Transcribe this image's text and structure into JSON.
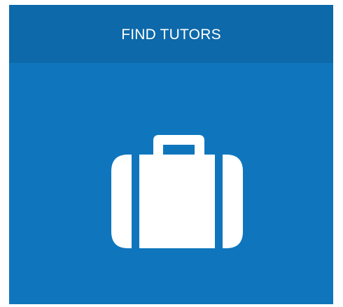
{
  "tile": {
    "title": "FIND TUTORS",
    "icon": "briefcase-icon",
    "colors": {
      "body": "#0f76be",
      "header": "#0d69a9",
      "text": "#ffffff"
    }
  }
}
